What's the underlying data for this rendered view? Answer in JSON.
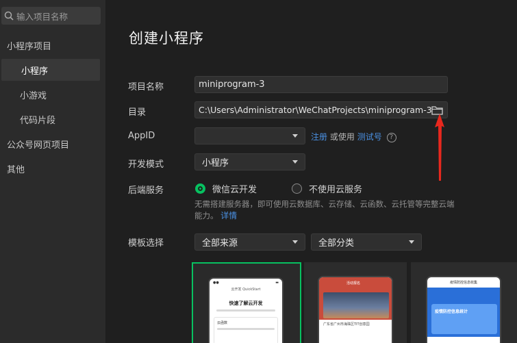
{
  "sidebar": {
    "search_placeholder": "输入项目名称",
    "items": [
      {
        "label": "小程序项目"
      },
      {
        "label": "小程序"
      },
      {
        "label": "小游戏"
      },
      {
        "label": "代码片段"
      },
      {
        "label": "公众号网页项目"
      },
      {
        "label": "其他"
      }
    ]
  },
  "main": {
    "title": "创建小程序",
    "project_name": {
      "label": "项目名称",
      "value": "miniprogram-3"
    },
    "directory": {
      "label": "目录",
      "value": "C:\\Users\\Administrator\\WeChatProjects\\miniprogram-3"
    },
    "appid": {
      "label": "AppID",
      "value": "",
      "register": "注册",
      "or_use": "或使用",
      "test_account": "测试号",
      "help": "?"
    },
    "dev_mode": {
      "label": "开发模式",
      "value": "小程序"
    },
    "backend": {
      "label": "后端服务",
      "option_cloud": "微信云开发",
      "option_none": "不使用云服务",
      "desc": "无需搭建服务器，即可使用云数据库、云存储、云函数、云托管等完整云端能力。",
      "details": "详情"
    },
    "template": {
      "label": "模板选择",
      "source": "全部来源",
      "category": "全部分类"
    },
    "templates": [
      {
        "title": "快速了解云开发",
        "header": "云开发 QuickStart",
        "card": "云函数"
      },
      {
        "title": "活动报名",
        "caption": "广东省广州市海珠区TIT创意园"
      },
      {
        "title": "疫情防控信息统计",
        "header": "疫情防控信息收集"
      }
    ]
  },
  "colors": {
    "accent": "#07c160",
    "link": "#4a90e2",
    "arrow": "#e8281e"
  }
}
